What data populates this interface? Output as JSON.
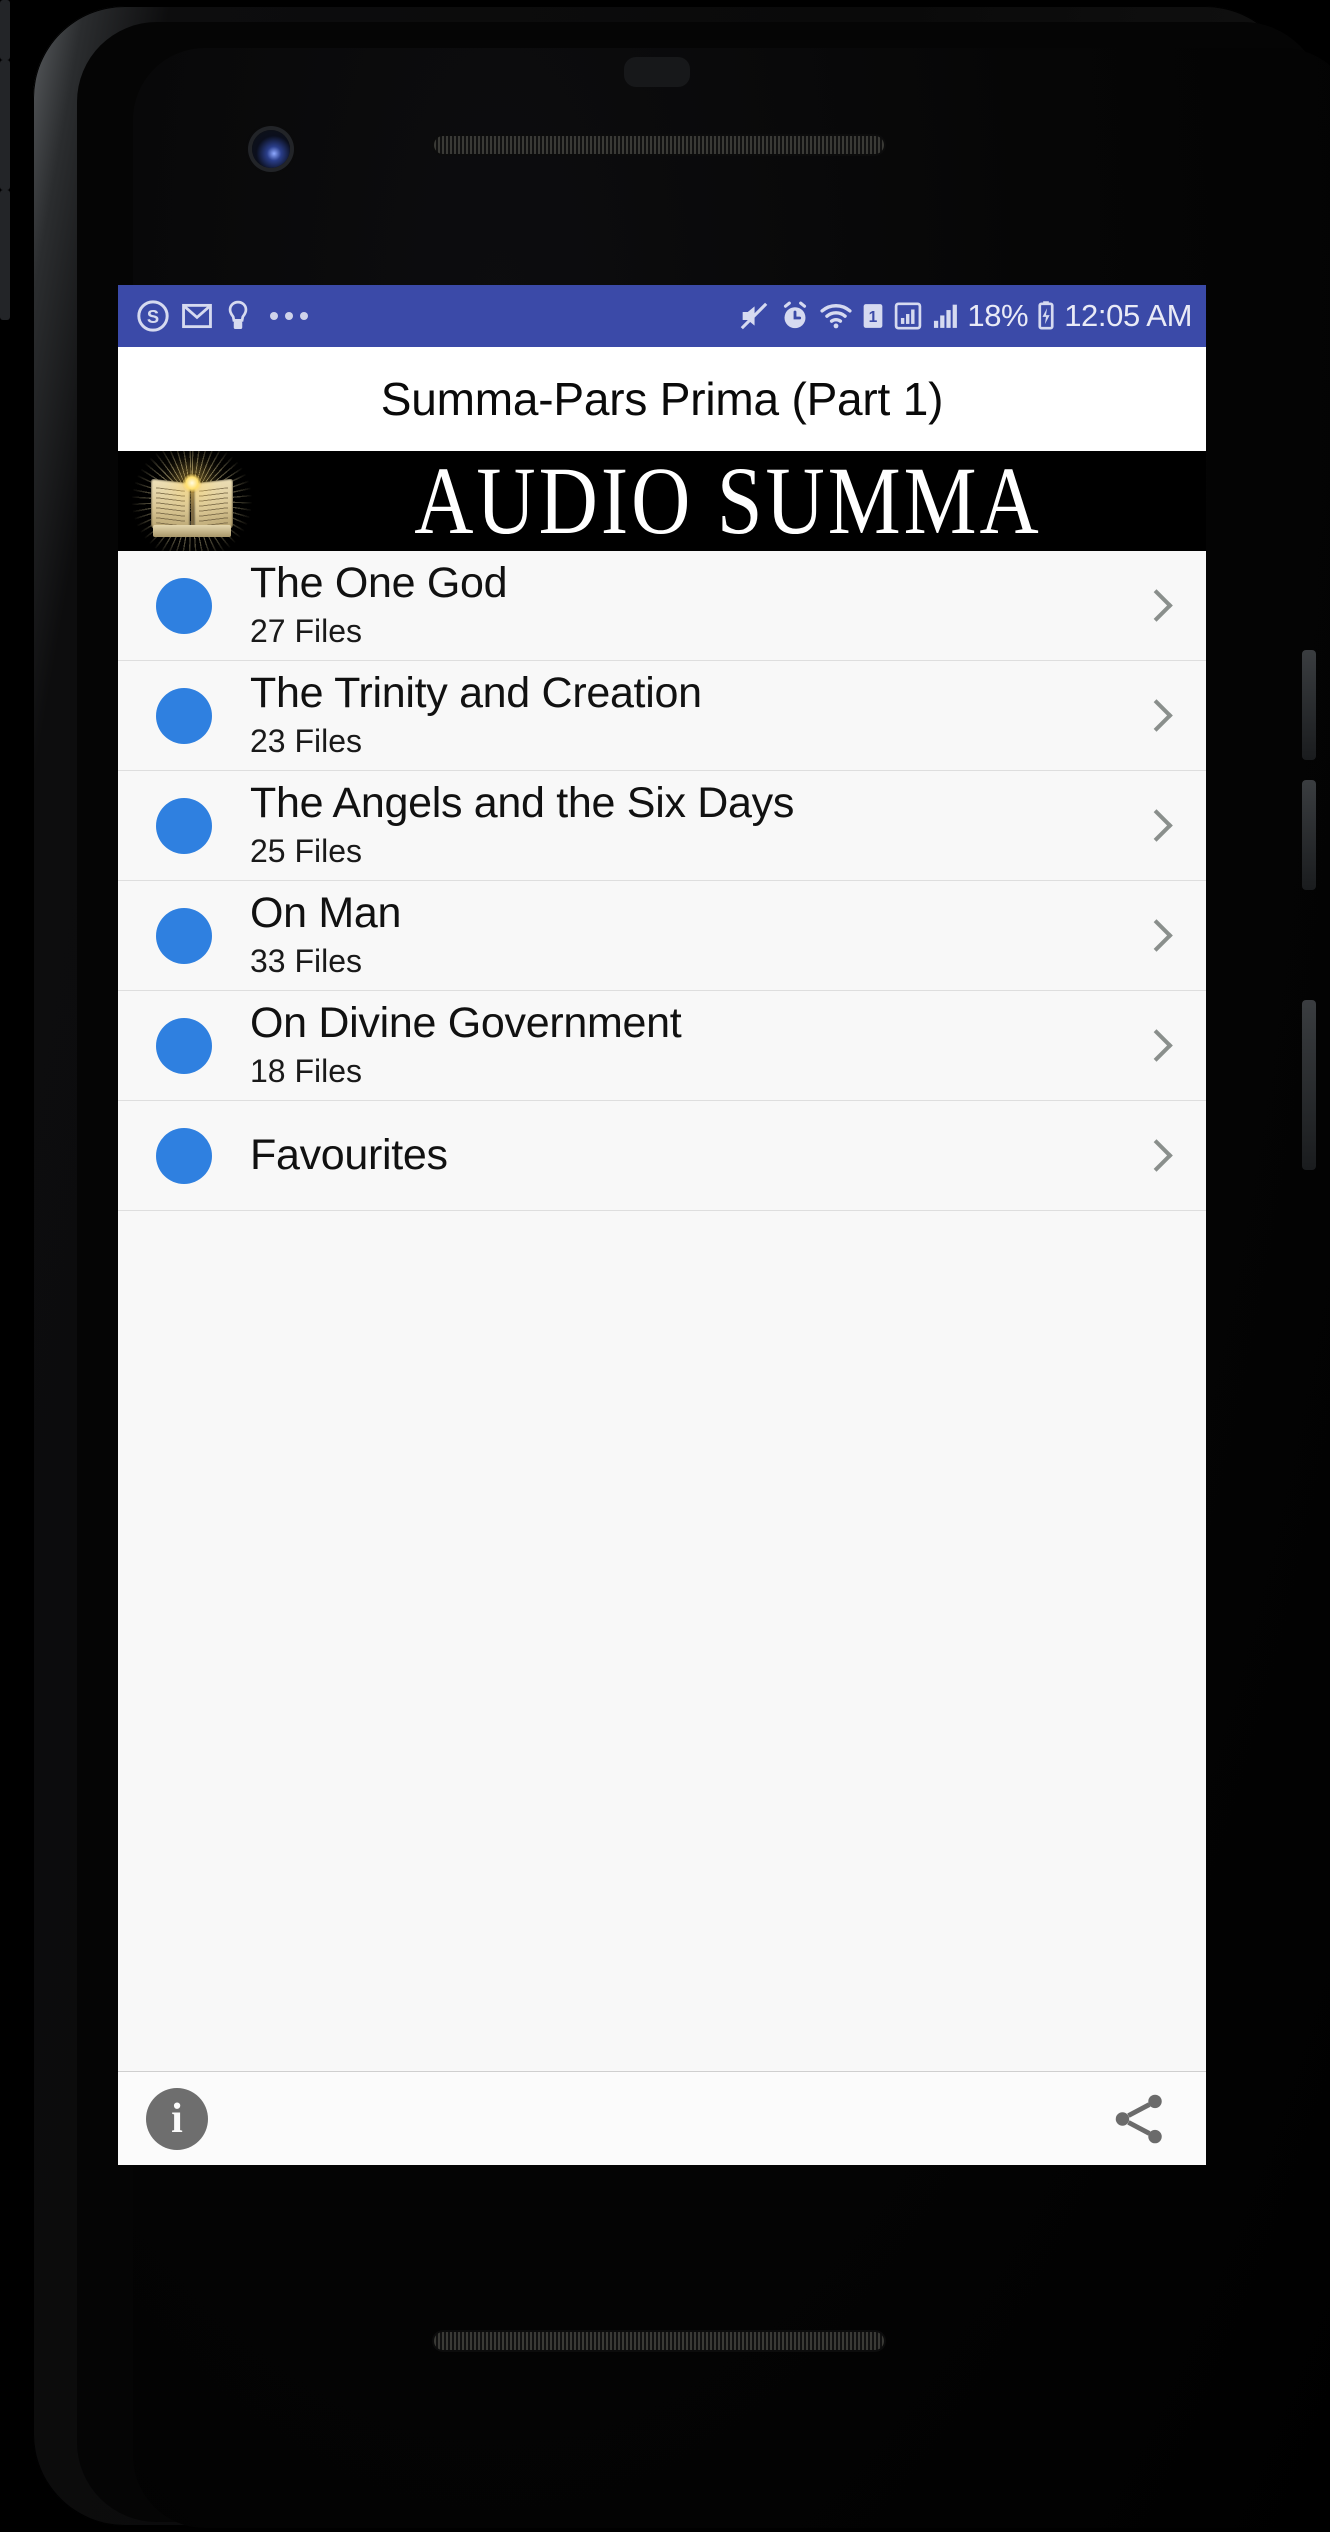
{
  "device": {
    "hardware": {
      "front_camera": "front-camera",
      "earpiece": "earpiece-speaker",
      "bottom_speaker": "bottom-speaker"
    }
  },
  "status_bar": {
    "background": "#3b4aa8",
    "left_icons": [
      {
        "name": "skype-icon",
        "glyph": "S"
      },
      {
        "name": "gmail-icon",
        "glyph": "M"
      },
      {
        "name": "lightbulb-icon",
        "glyph": "bulb"
      },
      {
        "name": "more-notifications-icon",
        "glyph": "..."
      }
    ],
    "right_icons": [
      {
        "name": "mute-icon",
        "glyph": "mute"
      },
      {
        "name": "alarm-icon",
        "glyph": "alarm"
      },
      {
        "name": "wifi-icon",
        "glyph": "wifi"
      },
      {
        "name": "sim-one-icon",
        "glyph": "1"
      },
      {
        "name": "signal-sim1-icon",
        "glyph": "bars"
      },
      {
        "name": "signal-sim2-icon",
        "glyph": "bars"
      }
    ],
    "battery_percent": "18%",
    "battery_icon": "battery-charging-icon",
    "clock": "12:05 AM"
  },
  "app": {
    "title": "Summa-Pars Prima (Part 1)",
    "banner": {
      "logo_text": "AUDIO SUMMA",
      "artwork": "open-book-with-light-rays",
      "background": "#000000"
    }
  },
  "list": {
    "bullet_color": "#2f80e0",
    "items": [
      {
        "title": "The One God",
        "subtitle": "27 Files"
      },
      {
        "title": "The Trinity and Creation",
        "subtitle": "23 Files"
      },
      {
        "title": "The Angels and the Six Days",
        "subtitle": "25 Files"
      },
      {
        "title": "On Man",
        "subtitle": "33 Files"
      },
      {
        "title": "On Divine Government",
        "subtitle": "18 Files"
      },
      {
        "title": "Favourites",
        "subtitle": ""
      }
    ]
  },
  "bottom_bar": {
    "info_label": "i",
    "info_name": "info-button",
    "share_name": "share-button"
  }
}
